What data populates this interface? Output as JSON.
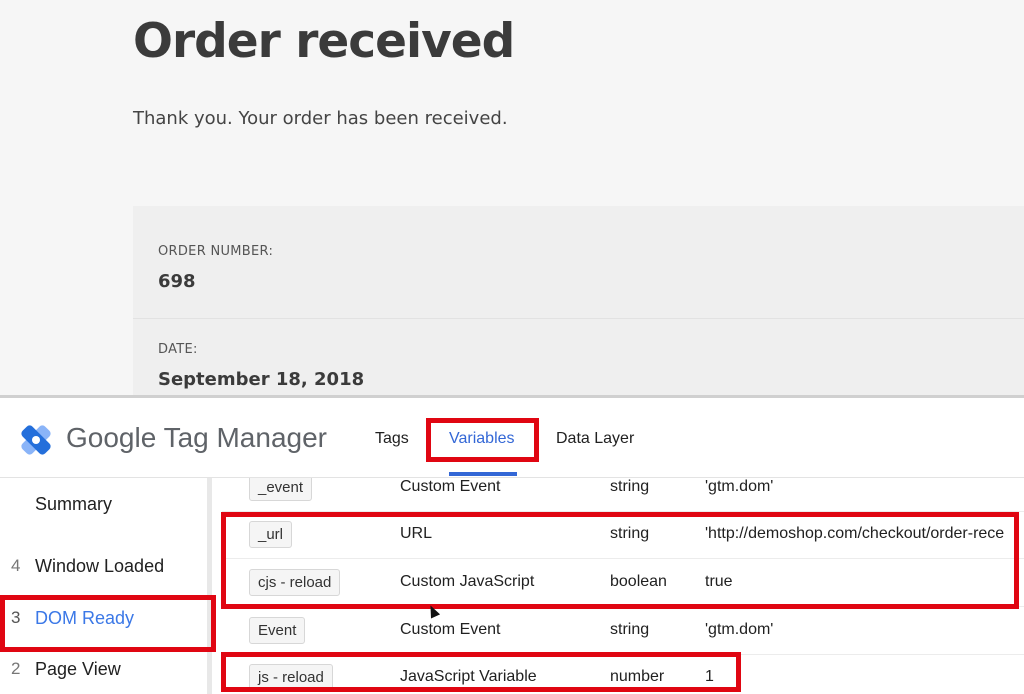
{
  "shop": {
    "title": "Order received",
    "thanks": "Thank you. Your order has been received.",
    "order_number_label": "ORDER NUMBER:",
    "order_number": "698",
    "date_label": "DATE:",
    "date": "September 18, 2018"
  },
  "gtm": {
    "brand": "Google Tag Manager",
    "tabs": [
      "Tags",
      "Variables",
      "Data Layer"
    ],
    "active_tab": "Variables",
    "sidebar": [
      {
        "num": "",
        "label": "Summary"
      },
      {
        "num": "4",
        "label": "Window Loaded"
      },
      {
        "num": "3",
        "label": "DOM Ready"
      },
      {
        "num": "2",
        "label": "Page View"
      }
    ],
    "active_sidebar": "DOM Ready",
    "variables": [
      {
        "name": "_event",
        "type": "Custom Event",
        "data_type": "string",
        "value": "'gtm.dom'"
      },
      {
        "name": "_url",
        "type": "URL",
        "data_type": "string",
        "value": "'http://demoshop.com/checkout/order-rece"
      },
      {
        "name": "cjs - reload",
        "type": "Custom JavaScript",
        "data_type": "boolean",
        "value": "true"
      },
      {
        "name": "Event",
        "type": "Custom Event",
        "data_type": "string",
        "value": "'gtm.dom'"
      },
      {
        "name": "js - reload",
        "type": "JavaScript Variable",
        "data_type": "number",
        "value": "1"
      }
    ]
  },
  "colors": {
    "highlight": "#e00612",
    "accent_blue": "#3367d6",
    "logo_blue_dark": "#246fdb",
    "logo_blue_light": "#8ab4f8"
  }
}
